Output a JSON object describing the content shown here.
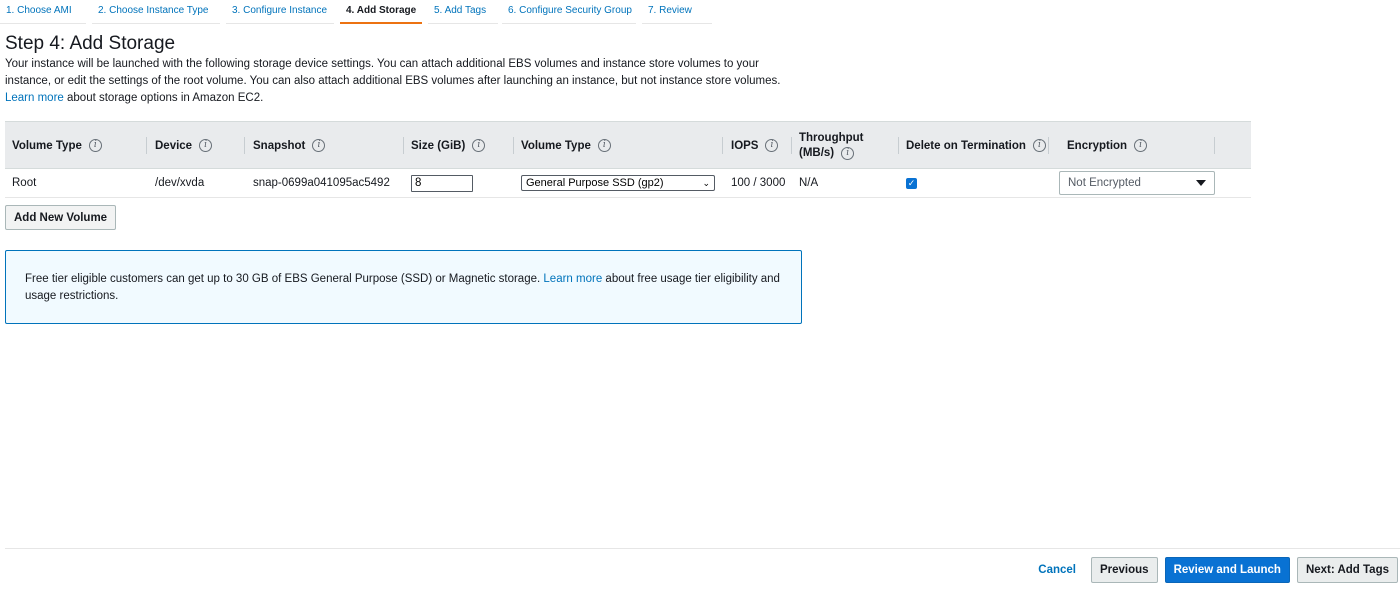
{
  "tabs": [
    {
      "label": "1. Choose AMI"
    },
    {
      "label": "2. Choose Instance Type"
    },
    {
      "label": "3. Configure Instance"
    },
    {
      "label": "4. Add Storage"
    },
    {
      "label": "5. Add Tags"
    },
    {
      "label": "6. Configure Security Group"
    },
    {
      "label": "7. Review"
    }
  ],
  "page": {
    "title": "Step 4: Add Storage",
    "intro_text": "Your instance will be launched with the following storage device settings. You can attach additional EBS volumes and instance store volumes to your instance, or edit the settings of the root volume. You can also attach additional EBS volumes after launching an instance, but not instance store volumes.",
    "intro_link": "Learn more",
    "intro_suffix": "about storage options in Amazon EC2."
  },
  "table": {
    "headers": {
      "volume_type": "Volume Type",
      "device": "Device",
      "snapshot": "Snapshot",
      "size": "Size (GiB)",
      "volume_type_2": "Volume Type",
      "iops": "IOPS",
      "throughput_line1": "Throughput",
      "throughput_line2": "(MB/s)",
      "delete_on_termination": "Delete on Termination",
      "encryption": "Encryption"
    },
    "rows": [
      {
        "volume_type": "Root",
        "device": "/dev/xvda",
        "snapshot": "snap-0699a041095ac5492",
        "size": "8",
        "ebs_type": "General Purpose SSD (gp2)",
        "iops": "100 / 3000",
        "throughput": "N/A",
        "delete_on_termination": true,
        "encryption": "Not Encrypted"
      }
    ]
  },
  "add_volume_label": "Add New Volume",
  "info_box": {
    "text": "Free tier eligible customers can get up to 30 GB of EBS General Purpose (SSD) or Magnetic storage.",
    "link": "Learn more",
    "suffix": "about free usage tier eligibility and usage restrictions."
  },
  "footer": {
    "cancel": "Cancel",
    "previous": "Previous",
    "review_launch": "Review and Launch",
    "next": "Next: Add Tags"
  },
  "colors": {
    "link": "#0073bb",
    "active_tab_underline": "#ec7211",
    "primary_button": "#0972d3",
    "info_box_border": "#0073bb",
    "info_box_bg": "#f1faff"
  },
  "icons": [
    "info-icon",
    "checkbox-checked-icon",
    "caret-down-icon",
    "chevron-down-icon"
  ]
}
